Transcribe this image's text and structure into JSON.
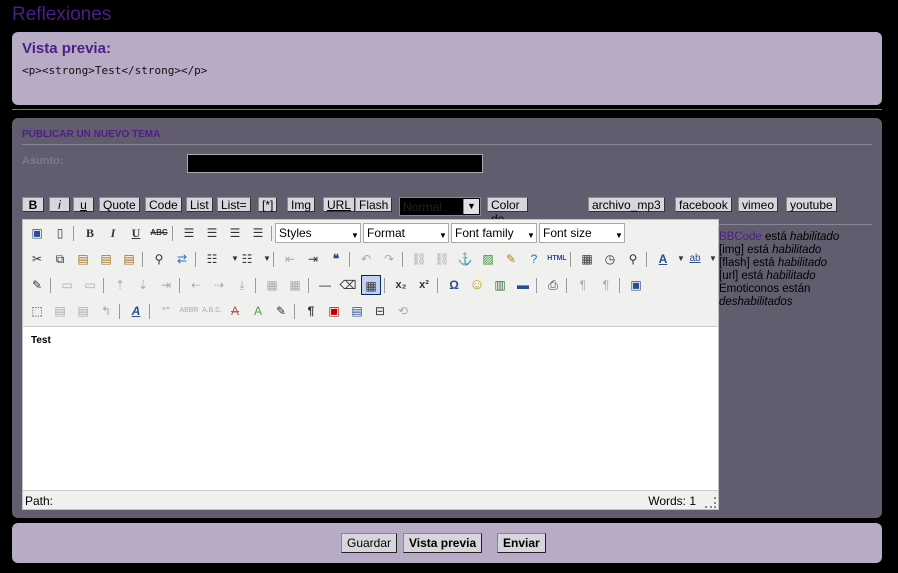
{
  "site": {
    "title": "Reflexiones"
  },
  "preview": {
    "heading": "Vista previa:",
    "content": "<p><strong>Test</strong></p>"
  },
  "form": {
    "title": "PUBLICAR UN NUEVO TEMA",
    "subject_label": "Asunto:",
    "subject_value": "",
    "bbcode_buttons": [
      "B",
      "i",
      "u",
      "Quote",
      "Code",
      "List",
      "List=",
      "[*]",
      "Img",
      "URL",
      "Flash"
    ],
    "size_select": "Normal",
    "extra_buttons": [
      "Color de fuente",
      "archivo_mp3",
      "facebook",
      "vimeo",
      "youtube"
    ]
  },
  "editor": {
    "styles_select": "Styles",
    "format_select": "Format",
    "font_family_select": "Font family",
    "font_size_select": "Font size",
    "content": "Test",
    "status_path": "Path:",
    "status_words": "Words: 1"
  },
  "side_info": {
    "bbcode_link": "BBCode",
    "bbcode_state": " está ",
    "bbcode_status": "habilitado",
    "img_text": "[img] está ",
    "img_status": "habilitado",
    "flash_text": "[flash] está ",
    "flash_status": "habilitado",
    "url_text": "[url] está ",
    "url_status": "habilitado",
    "smilies_text": "Emoticonos están ",
    "smilies_status": "deshabilitados"
  },
  "footer": {
    "save": "Guardar",
    "preview": "Vista previa",
    "submit": "Enviar"
  }
}
